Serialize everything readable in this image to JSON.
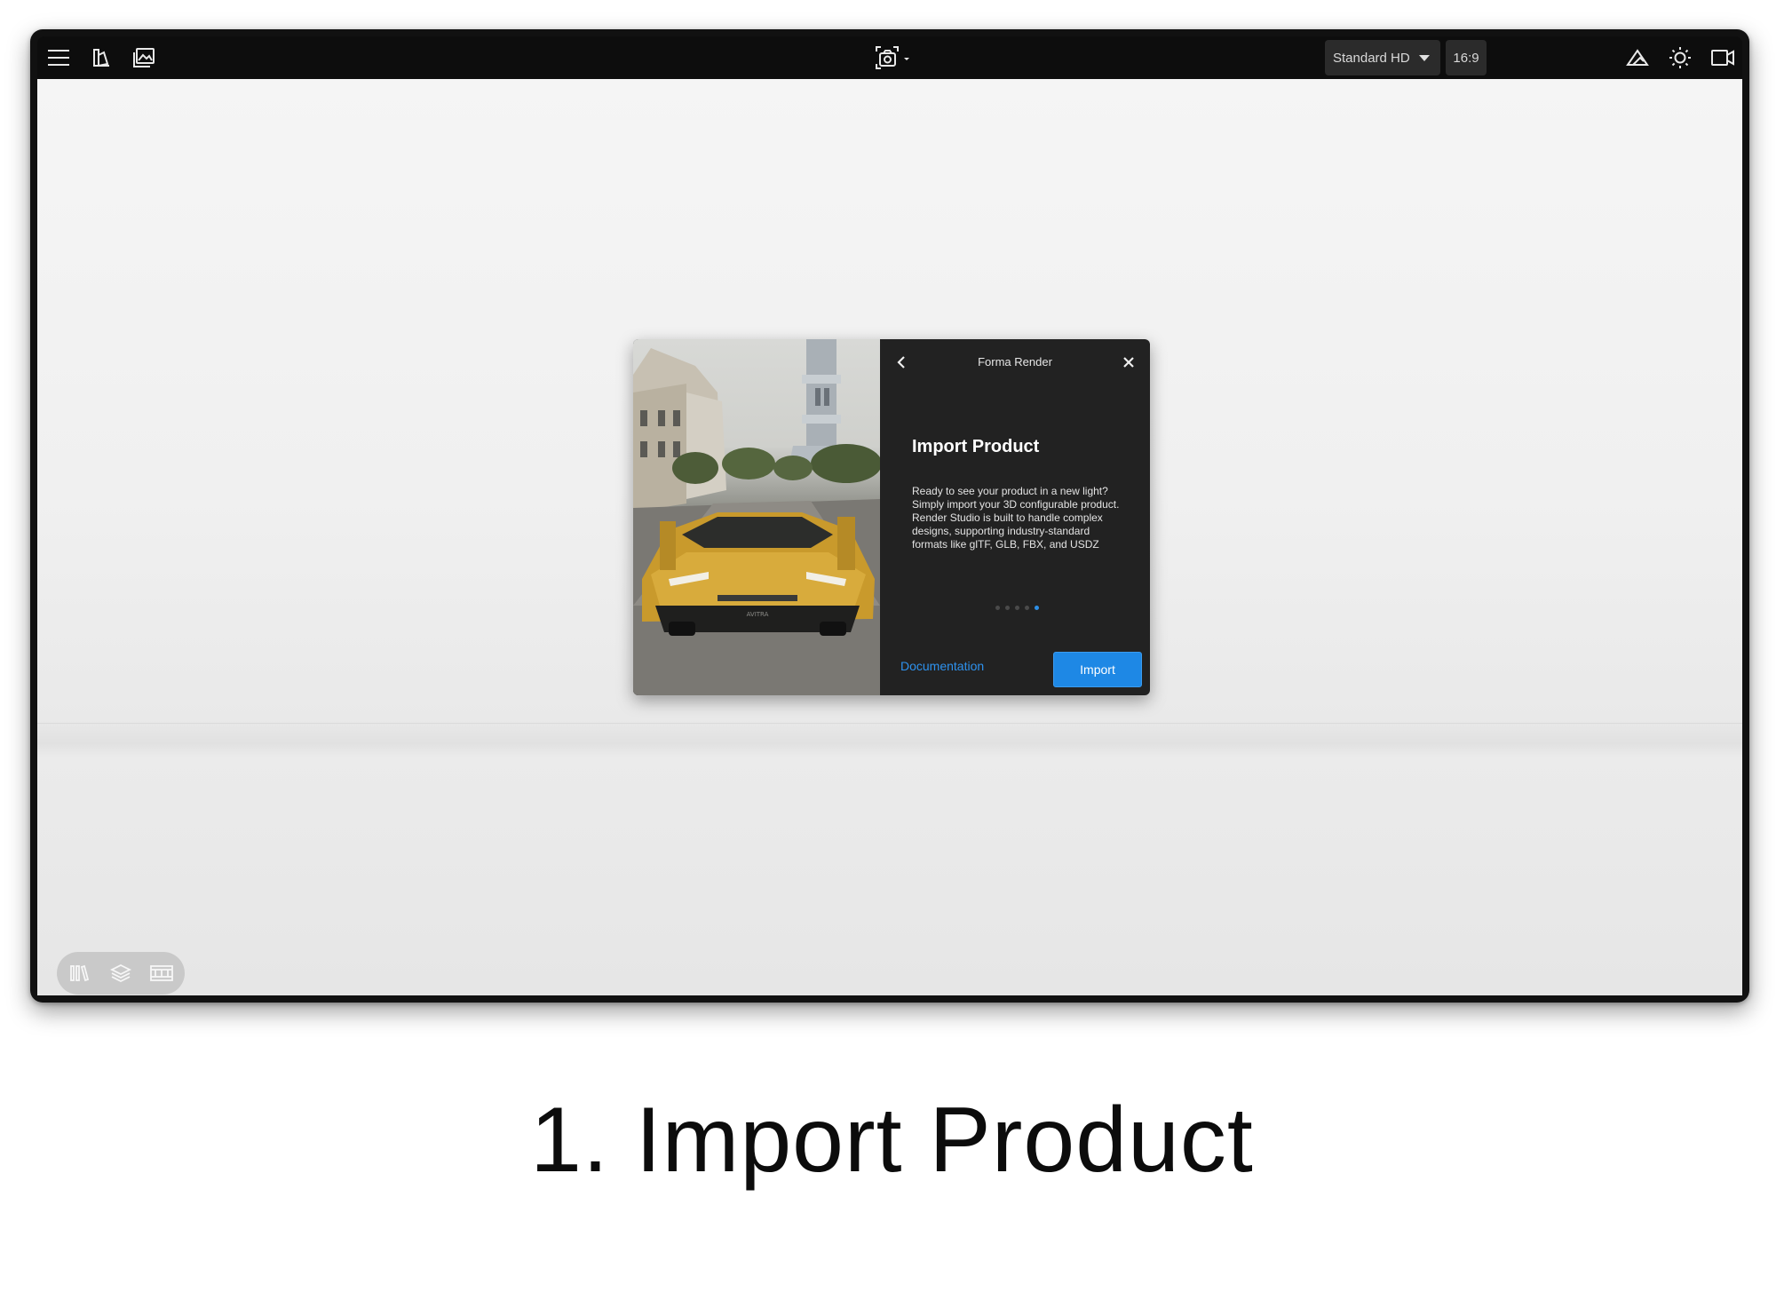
{
  "toolbar": {
    "resolution": {
      "selected": "Standard HD"
    },
    "aspect_ratio": "16:9",
    "left_icons": [
      "menu-icon",
      "materials-icon",
      "image-gallery-icon"
    ],
    "center_icon": "camera-capture-icon",
    "right_icons": [
      "environment-icon",
      "lighting-icon",
      "camera-view-icon"
    ]
  },
  "dialog": {
    "title": "Forma Render",
    "heading": "Import Product",
    "body": "Ready to see your product in a new light? Simply import your 3D configurable product. Render Studio is built to handle complex designs, supporting industry-standard formats like glTF, GLB, FBX, and USDZ",
    "pagination": {
      "total": 5,
      "current": 5
    },
    "documentation_link": "Documentation",
    "import_button": "Import",
    "image_plate_text": "AVITRA"
  },
  "bottom_tools": [
    "library-icon",
    "layers-icon",
    "filmstrip-icon"
  ],
  "caption": "1. Import Product",
  "colors": {
    "accent": "#1e88e5",
    "toolbar_bg": "#0d0d0d",
    "dialog_bg": "#222222",
    "link": "#2e92ee"
  }
}
